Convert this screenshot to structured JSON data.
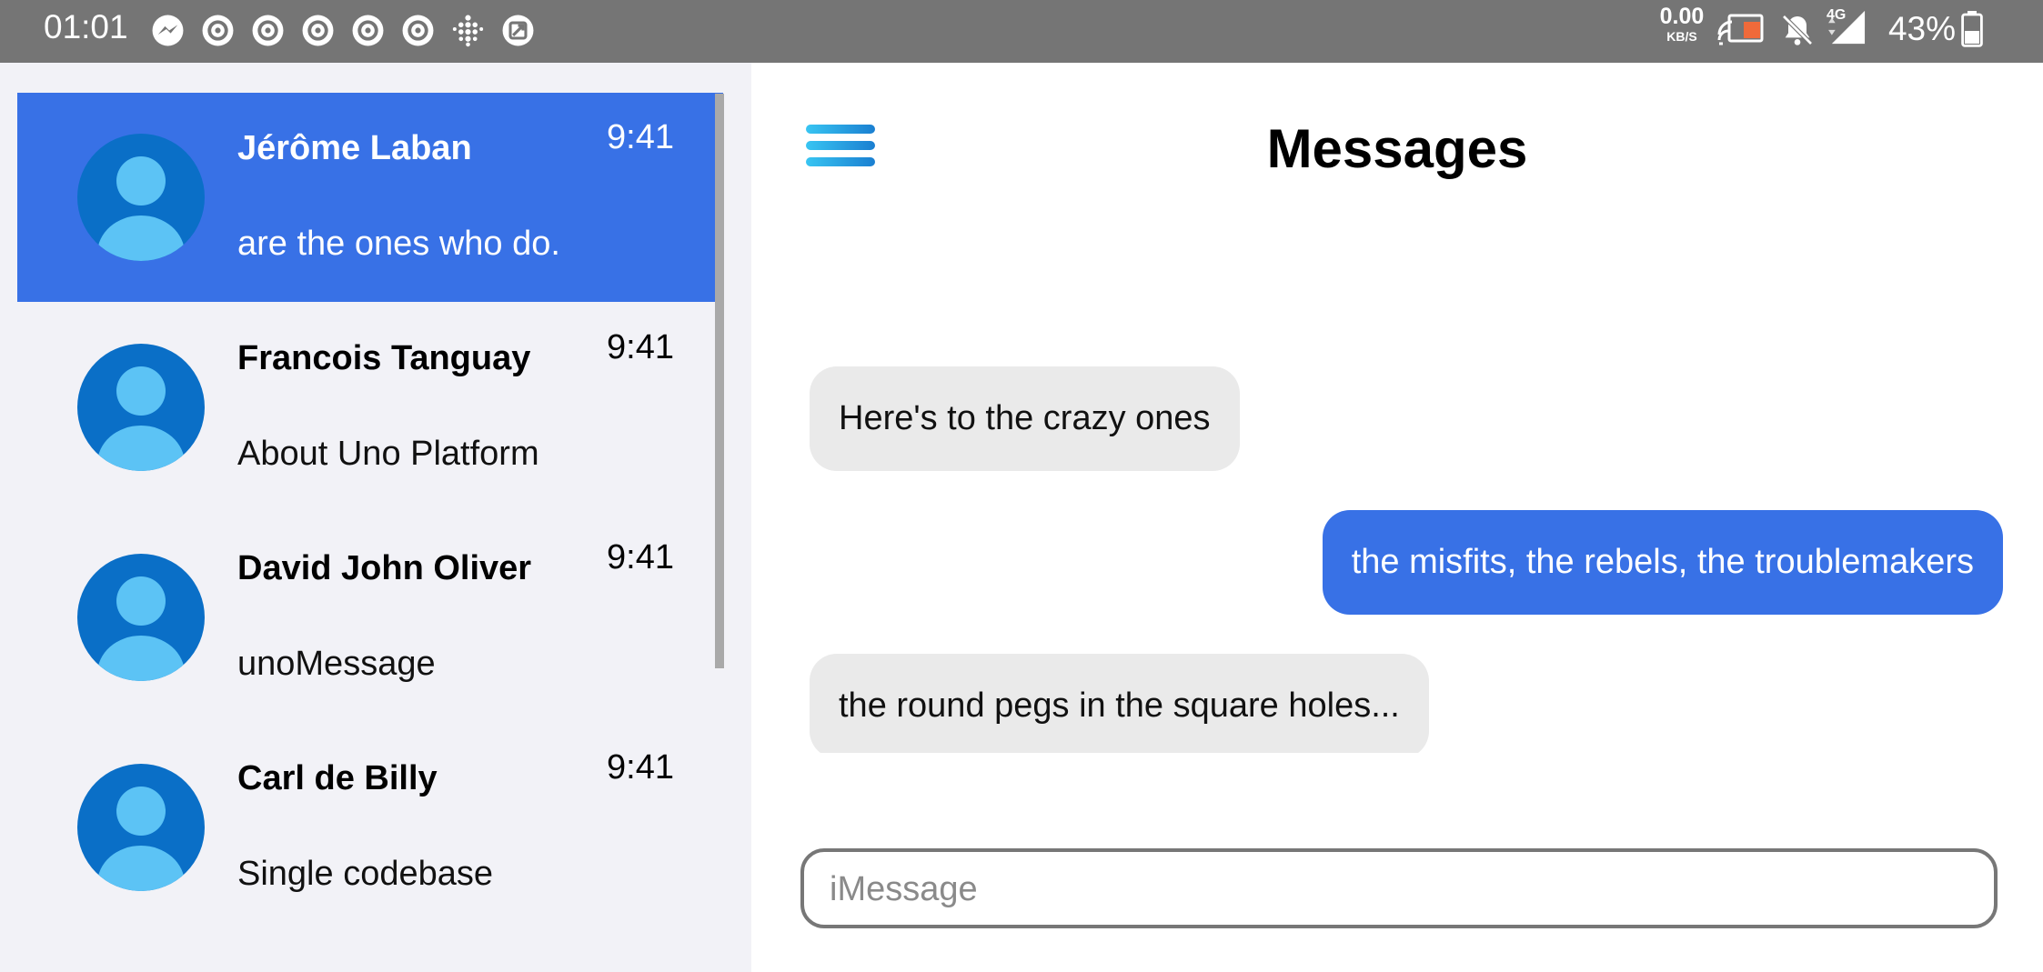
{
  "status_bar": {
    "time": "01:01",
    "left_icons": [
      "messenger-icon",
      "circle-app-icon",
      "circle-app-icon",
      "circle-app-icon",
      "circle-app-icon",
      "circle-app-icon",
      "dots-grid-icon",
      "image-box-icon"
    ],
    "network_speed_value": "0.00",
    "network_speed_unit": "KB/S",
    "network_type": "4G",
    "battery_percent": "43%"
  },
  "conversations": [
    {
      "name": "Jérôme Laban",
      "time": "9:41",
      "preview": "are the ones who do.",
      "selected": true
    },
    {
      "name": "Francois Tanguay",
      "time": "9:41",
      "preview": "About Uno Platform",
      "selected": false
    },
    {
      "name": "David John Oliver",
      "time": "9:41",
      "preview": "unoMessage",
      "selected": false
    },
    {
      "name": "Carl de Billy",
      "time": "9:41",
      "preview": "Single codebase",
      "selected": false
    }
  ],
  "chat": {
    "title": "Messages",
    "messages": [
      {
        "direction": "incoming",
        "text": "Here's to the crazy ones"
      },
      {
        "direction": "outgoing",
        "text": "the misfits, the rebels, the troublemakers"
      },
      {
        "direction": "incoming",
        "text": "the round pegs in the square holes..."
      },
      {
        "direction": "outgoing",
        "text": ""
      }
    ],
    "composer_placeholder": "iMessage"
  },
  "colors": {
    "accent": "#3871e6",
    "incoming_bubble": "#eaeaea",
    "list_background": "#f2f2f7",
    "status_bar": "#757575"
  }
}
